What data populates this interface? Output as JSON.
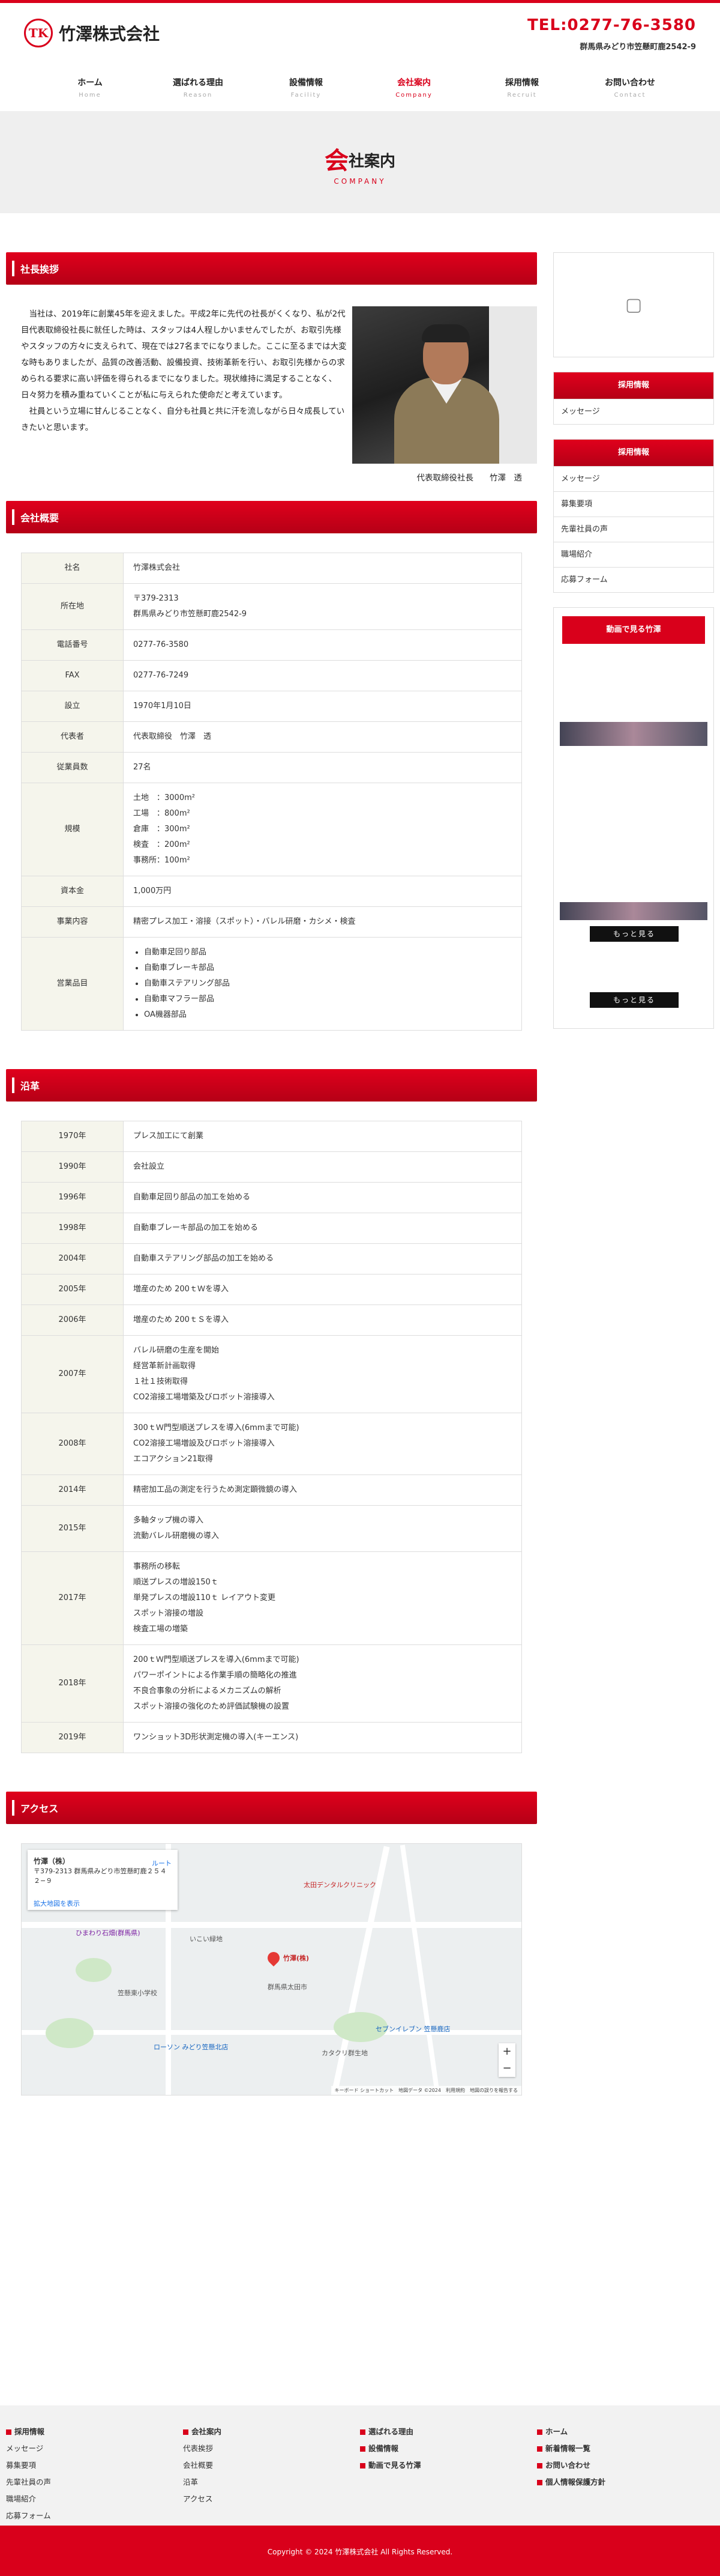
{
  "header": {
    "logo_mark": "TK",
    "company_name": "竹澤株式会社",
    "tel": "TEL:0277-76-3580",
    "address": "群馬県みどり市笠懸町鹿2542-9"
  },
  "nav": [
    {
      "jp": "ホーム",
      "en": "Home"
    },
    {
      "jp": "選ばれる理由",
      "en": "Reason"
    },
    {
      "jp": "設備情報",
      "en": "Facility"
    },
    {
      "jp": "会社案内",
      "en": "Company"
    },
    {
      "jp": "採用情報",
      "en": "Recruit"
    },
    {
      "jp": "お問い合わせ",
      "en": "Contact"
    }
  ],
  "banner": {
    "big_char": "会",
    "rest": "社案内",
    "sub": "COMPANY"
  },
  "greeting": {
    "heading": "社長挨拶",
    "paragraph1": "当社は、2019年に創業45年を迎えました。平成2年に先代の社長がくくなり、私が2代目代表取締役社長に就任した時は、スタッフは4人程しかいませんでしたが、お取引先様やスタッフの方々に支えられて、現在では27名までになりました。ここに至るまでは大変な時もありましたが、品質の改善活動、設備投資、技術革新を行い、お取引先様からの求められる要求に高い評価を得られるまでになりました。現状維持に満足することなく、日々努力を積み重ねていくことが私に与えられた使命だと考えています。",
    "paragraph2": "社員という立場に甘んじることなく、自分も社員と共に汗を流しながら日々成長していきたいと思います。",
    "signature": "代表取締役社長　　竹澤　透"
  },
  "overview": {
    "heading": "会社概要",
    "rows": [
      {
        "k": "社名",
        "v": [
          "竹澤株式会社"
        ]
      },
      {
        "k": "所在地",
        "v": [
          "〒379-2313",
          "群馬県みどり市笠懸町鹿2542-9"
        ]
      },
      {
        "k": "電話番号",
        "v": [
          "0277-76-3580"
        ]
      },
      {
        "k": "FAX",
        "v": [
          "0277-76-7249"
        ]
      },
      {
        "k": "設立",
        "v": [
          "1970年1月10日"
        ]
      },
      {
        "k": "代表者",
        "v": [
          "代表取締役　竹澤　透"
        ]
      },
      {
        "k": "従業員数",
        "v": [
          "27名"
        ]
      },
      {
        "k": "規模",
        "v": [
          "土地　：3000m²",
          "工場　：800m²",
          "倉庫　：300m²",
          "検査　：200m²",
          "事務所：100m²"
        ]
      },
      {
        "k": "資本金",
        "v": [
          "1,000万円"
        ]
      },
      {
        "k": "事業内容",
        "v": [
          "精密プレス加工・溶接（スポット）・バレル研磨・カシメ・検査"
        ]
      }
    ],
    "products_label": "営業品目",
    "products": [
      "自動車足回り部品",
      "自動車ブレーキ部品",
      "自動車ステアリング部品",
      "自動車マフラー部品",
      "OA機器部品"
    ]
  },
  "history": {
    "heading": "沿革",
    "rows": [
      {
        "y": "1970年",
        "v": [
          "プレス加工にて創業"
        ]
      },
      {
        "y": "1990年",
        "v": [
          "会社設立"
        ]
      },
      {
        "y": "1996年",
        "v": [
          "自動車足回り部品の加工を始める"
        ]
      },
      {
        "y": "1998年",
        "v": [
          "自動車ブレーキ部品の加工を始める"
        ]
      },
      {
        "y": "2004年",
        "v": [
          "自動車ステアリング部品の加工を始める"
        ]
      },
      {
        "y": "2005年",
        "v": [
          "増産のため 200ｔＷを導入"
        ]
      },
      {
        "y": "2006年",
        "v": [
          "増産のため 200ｔＳを導入"
        ]
      },
      {
        "y": "2007年",
        "v": [
          "バレル研磨の生産を開始",
          "経営革新計画取得",
          "１社１技術取得",
          "CO2溶接工場増築及びロボット溶接導入"
        ]
      },
      {
        "y": "2008年",
        "v": [
          "300ｔＷ門型順送プレスを導入(6mmまで可能)",
          "CO2溶接工場増設及びロボット溶接導入",
          "エコアクション21取得"
        ]
      },
      {
        "y": "2014年",
        "v": [
          "精密加工品の測定を行うため測定顕微鏡の導入"
        ]
      },
      {
        "y": "2015年",
        "v": [
          "多軸タップ機の導入",
          "流動バレル研磨機の導入"
        ]
      },
      {
        "y": "2017年",
        "v": [
          "事務所の移転",
          "順送プレスの増設150ｔ",
          "単発プレスの増設110ｔ レイアウト変更",
          "スポット溶接の増設",
          "検査工場の増築"
        ]
      },
      {
        "y": "2018年",
        "v": [
          "200ｔＷ門型順送プレスを導入(6mmまで可能)",
          "パワーポイントによる作業手順の簡略化の推進",
          "不良合事象の分析によるメカニズムの解析",
          "スポット溶接の強化のため評価試験機の設置"
        ]
      },
      {
        "y": "2019年",
        "v": [
          "ワンショット3D形状測定機の導入(キーエンス)"
        ]
      }
    ]
  },
  "access": {
    "heading": "アクセス",
    "map_title": "竹澤（株）",
    "map_address": "〒379-2313 群馬県みどり市笠懸町鹿２５４２−９",
    "map_route": "ルート",
    "map_enlarge": "拡大地図を表示",
    "pin_label": "竹澤(株)",
    "labels": [
      "ひまわり石畑(群馬県)",
      "いこい緑地",
      "笠懸東小学校",
      "ローソン みどり笠懸北店",
      "カタクリ群生地",
      "セブンイレブン 笠懸鹿店",
      "太田デンタルクリニック",
      "群馬県太田市"
    ],
    "map_footer": "キーボード ショートカット　地図データ ©2024　利用規約　地図の誤りを報告する"
  },
  "sidebar": {
    "recruit_box1": {
      "head": "採用情報",
      "items": [
        "メッセージ"
      ]
    },
    "recruit_box2": {
      "head": "採用情報",
      "items": [
        "メッセージ",
        "募集要項",
        "先輩社員の声",
        "職場紹介",
        "応募フォーム"
      ]
    },
    "video": {
      "button": "動画で見る竹澤",
      "more1": "もっと見る",
      "more2": "もっと見る"
    }
  },
  "footer": {
    "col1": {
      "head": "採用情報",
      "items": [
        "メッセージ",
        "募集要項",
        "先輩社員の声",
        "職場紹介",
        "応募フォーム"
      ]
    },
    "col2": {
      "head": "会社案内",
      "items": [
        "代表挨拶",
        "会社概要",
        "沿革",
        "アクセス"
      ]
    },
    "col3": {
      "heads": [
        "選ばれる理由",
        "設備情報",
        "動画で見る竹澤"
      ]
    },
    "col4": {
      "heads": [
        "ホーム",
        "新着情報一覧",
        "お問い合わせ",
        "個人情報保護方針"
      ]
    },
    "copyright": "Copyright © 2024 竹澤株式会社 All Rights Reserved."
  },
  "colors": {
    "accent": "#d9001b",
    "table_header_bg": "#f5f5ec",
    "footer_bg": "#f2f2f2"
  }
}
